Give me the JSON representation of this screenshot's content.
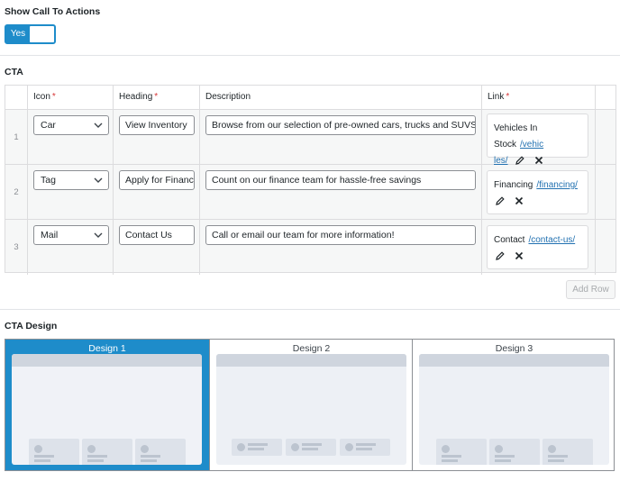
{
  "show_cta": {
    "label": "Show Call To Actions",
    "toggle_value": "Yes"
  },
  "cta": {
    "label": "CTA",
    "columns": {
      "icon": "Icon",
      "heading": "Heading",
      "description": "Description",
      "link": "Link",
      "required_mark": "*"
    },
    "rows": [
      {
        "num": "1",
        "icon": "Car",
        "heading": "View Inventory",
        "description": "Browse from our selection of pre-owned cars, trucks and SUVS",
        "link_text": "Vehicles In Stock",
        "link_url_1": "/vehic",
        "link_url_2": "les/"
      },
      {
        "num": "2",
        "icon": "Tag",
        "heading": "Apply for Financ",
        "description": "Count on our finance team for hassle-free savings",
        "link_text": "Financing",
        "link_url_1": "/financing/",
        "link_url_2": ""
      },
      {
        "num": "3",
        "icon": "Mail",
        "heading": "Contact Us",
        "description": "Call or email our team for more information!",
        "link_text": "Contact",
        "link_url_1": "/contact-us/",
        "link_url_2": ""
      }
    ],
    "add_row_label": "Add Row"
  },
  "cta_design": {
    "label": "CTA Design",
    "options": [
      "Design 1",
      "Design 2",
      "Design 3"
    ],
    "selected": "Design 1"
  },
  "colors": {
    "accent": "#1e8cca",
    "required": "#d63638",
    "link": "#2271b1"
  },
  "icons": [
    "chevron-down-icon",
    "pencil-icon",
    "close-icon"
  ]
}
